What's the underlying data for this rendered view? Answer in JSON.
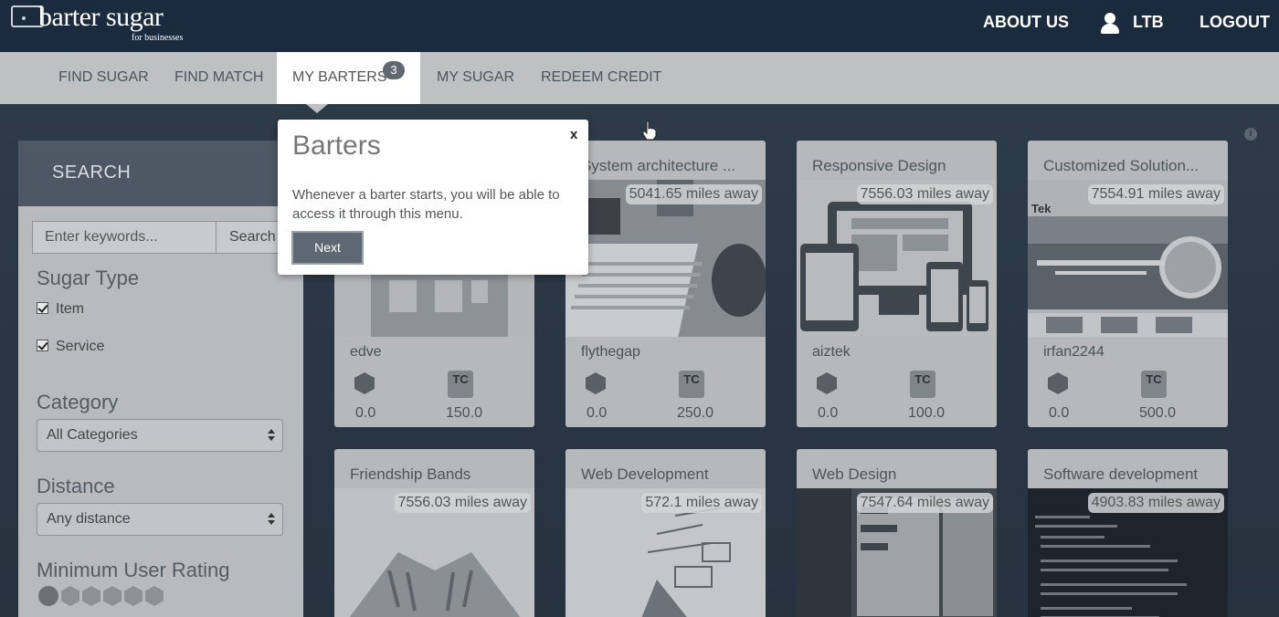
{
  "brand": {
    "name": "barter sugar",
    "tagline": "for businesses"
  },
  "top_nav": {
    "about": "ABOUT US",
    "user": "LTB",
    "logout": "LOGOUT"
  },
  "nav": {
    "items": [
      "FIND SUGAR",
      "FIND MATCH",
      "MY BARTERS",
      "MY SUGAR",
      "REDEEM CREDIT"
    ],
    "active": "MY BARTERS",
    "badge": "3"
  },
  "sidebar": {
    "header": "SEARCH",
    "search_placeholder": "Enter keywords...",
    "search_button": "Search",
    "sugar_type_title": "Sugar Type",
    "sugar_types": [
      "Item",
      "Service"
    ],
    "category_title": "Category",
    "category_value": "All Categories",
    "distance_title": "Distance",
    "distance_value": "Any distance",
    "rating_title": "Minimum User Rating"
  },
  "cards": [
    {
      "title": "",
      "distance": "",
      "user": "edve",
      "cube_value": "0.0",
      "tc_value": "150.0"
    },
    {
      "title": "System architecture ...",
      "distance": "5041.65 miles away",
      "user": "flythegap",
      "cube_value": "0.0",
      "tc_value": "250.0"
    },
    {
      "title": "Responsive Design",
      "distance": "7556.03 miles away",
      "user": "aiztek",
      "cube_value": "0.0",
      "tc_value": "100.0"
    },
    {
      "title": "Customized Solution...",
      "distance": "7554.91 miles away",
      "user": "irfan2244",
      "cube_value": "0.0",
      "tc_value": "500.0"
    },
    {
      "title": "Friendship Bands",
      "distance": "7556.03 miles away"
    },
    {
      "title": "Web Development",
      "distance": "572.1 miles away"
    },
    {
      "title": "Web Design",
      "distance": "7547.64 miles away"
    },
    {
      "title": "Software development",
      "distance": "4903.83 miles away"
    }
  ],
  "tc_label": "TC",
  "popup": {
    "title": "Barters",
    "close": "x",
    "text": "Whenever a barter starts, you will be able to access it through this menu.",
    "next": "Next"
  },
  "colors": {
    "topbar": "#1b2a3d",
    "navbar": "#bfc0c2",
    "accent": "#5e6872"
  }
}
